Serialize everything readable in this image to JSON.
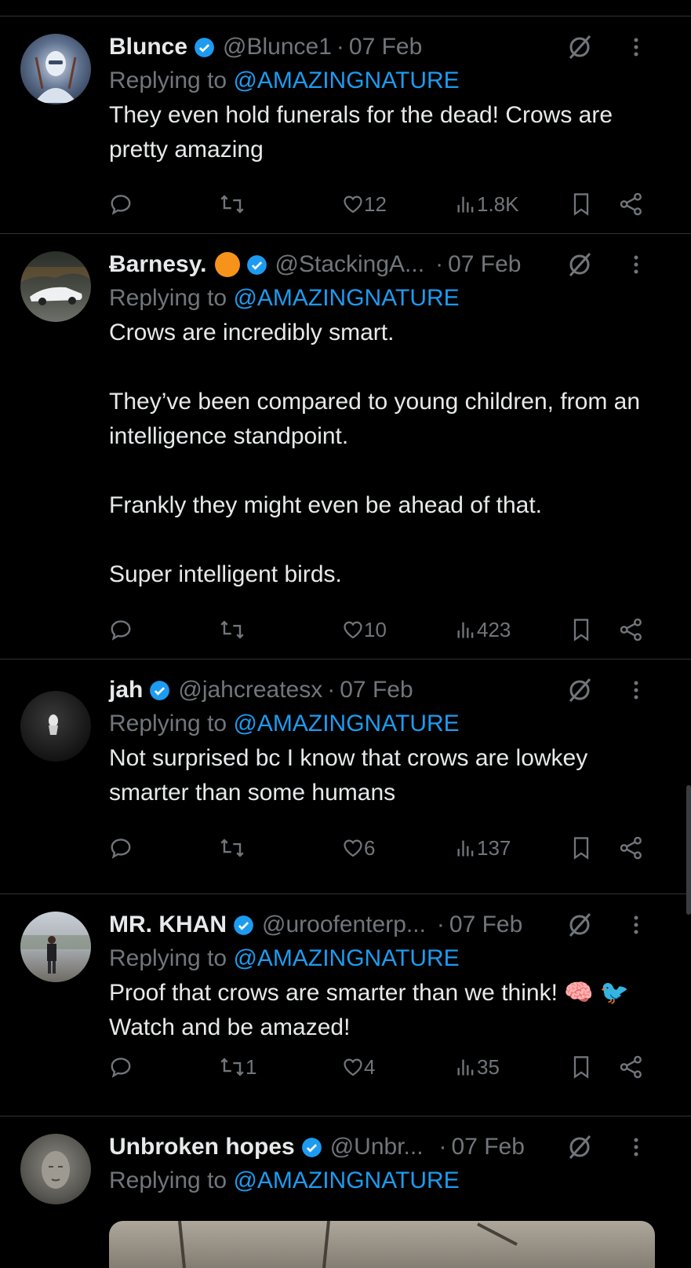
{
  "colors": {
    "accent": "#1d9bf0",
    "muted": "#71767b",
    "text": "#e7e9ea",
    "background": "#000000"
  },
  "tweets": [
    {
      "name": "Blunce",
      "handle": "@Blunce1",
      "date": "07 Feb",
      "replying_prefix": "Replying to ",
      "replying_to": "@AMAZINGNATURE",
      "text": [
        "They even hold funerals for the dead! Crows are pretty amazing"
      ],
      "replies": "",
      "reposts": "",
      "likes": "12",
      "views": "1.8K"
    },
    {
      "name": "Ƀarnesy.",
      "badge": "orange-circle",
      "handle": "@StackingA...",
      "date": "07 Feb",
      "replying_prefix": "Replying to ",
      "replying_to": "@AMAZINGNATURE",
      "text": [
        "Crows are incredibly smart.",
        "They’ve been compared to young children, from an intelligence standpoint.",
        "Frankly they might even be ahead of that.",
        "Super intelligent birds."
      ],
      "replies": "",
      "reposts": "",
      "likes": "10",
      "views": "423"
    },
    {
      "name": "jah",
      "handle": "@jahcreatesx",
      "date": "07 Feb",
      "replying_prefix": "Replying to ",
      "replying_to": "@AMAZINGNATURE",
      "text": [
        "Not surprised bc I know that crows are lowkey smarter than some humans"
      ],
      "replies": "",
      "reposts": "",
      "likes": "6",
      "views": "137"
    },
    {
      "name": "MR. KHAN",
      "handle": "@uroofenterp...",
      "date": "07 Feb",
      "replying_prefix": "Replying to ",
      "replying_to": "@AMAZINGNATURE",
      "text": [
        "Proof that crows are smarter than we think! 🧠 🐦 Watch and be amazed!"
      ],
      "replies": "",
      "reposts": "1",
      "likes": "4",
      "views": "35"
    },
    {
      "name": "Unbroken hopes",
      "handle": "@Unbr...",
      "date": "07 Feb",
      "replying_prefix": "Replying to ",
      "replying_to": "@AMAZINGNATURE",
      "text": []
    }
  ]
}
